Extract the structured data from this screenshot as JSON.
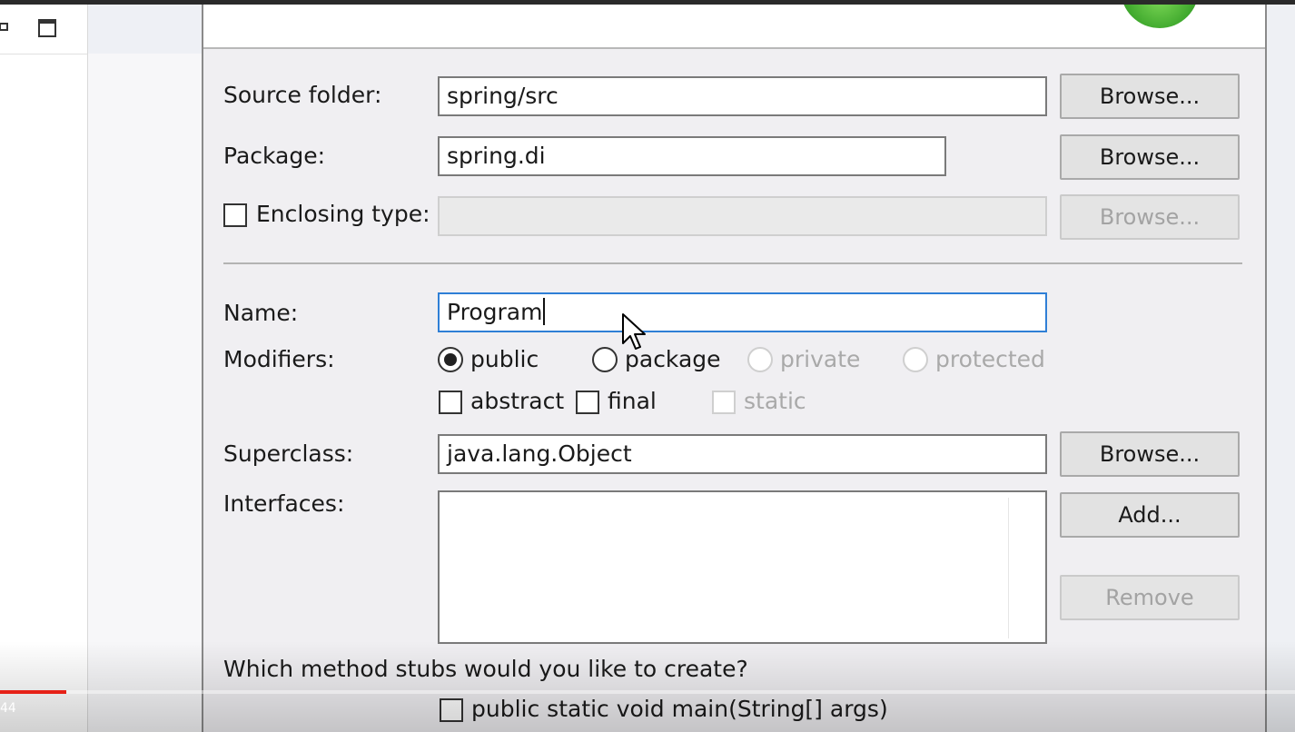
{
  "form": {
    "source_folder": {
      "label": "Source folder:",
      "value": "spring/src",
      "browse": "Browse..."
    },
    "package": {
      "label": "Package:",
      "value": "spring.di",
      "browse": "Browse..."
    },
    "enclosing_type": {
      "label": "Enclosing type:",
      "value": "",
      "browse": "Browse...",
      "checked": false
    },
    "name": {
      "label": "Name:",
      "value": "Program"
    },
    "modifiers": {
      "label": "Modifiers:",
      "access": [
        {
          "label": "public",
          "selected": true,
          "enabled": true
        },
        {
          "label": "package",
          "selected": false,
          "enabled": true
        },
        {
          "label": "private",
          "selected": false,
          "enabled": false
        },
        {
          "label": "protected",
          "selected": false,
          "enabled": false
        }
      ],
      "flags": [
        {
          "label": "abstract",
          "checked": false,
          "enabled": true
        },
        {
          "label": "final",
          "checked": false,
          "enabled": true
        },
        {
          "label": "static",
          "checked": false,
          "enabled": false
        }
      ]
    },
    "superclass": {
      "label": "Superclass:",
      "value": "java.lang.Object",
      "browse": "Browse..."
    },
    "interfaces": {
      "label": "Interfaces:",
      "add": "Add...",
      "remove": "Remove",
      "items": []
    },
    "method_stubs": {
      "question": "Which method stubs would you like to create?",
      "options": [
        {
          "label": "public static void main(String[] args)",
          "checked": false
        }
      ]
    }
  },
  "video_overlay": {
    "time_fragment": "44",
    "progress_color": "#e62117"
  },
  "colors": {
    "focus_border": "#2f7fd6",
    "logo_green": "#3fa82d"
  },
  "icons": {
    "left_toolbar": [
      "restore-icon",
      "maximize-icon"
    ],
    "header": "wizard-logo-icon"
  }
}
